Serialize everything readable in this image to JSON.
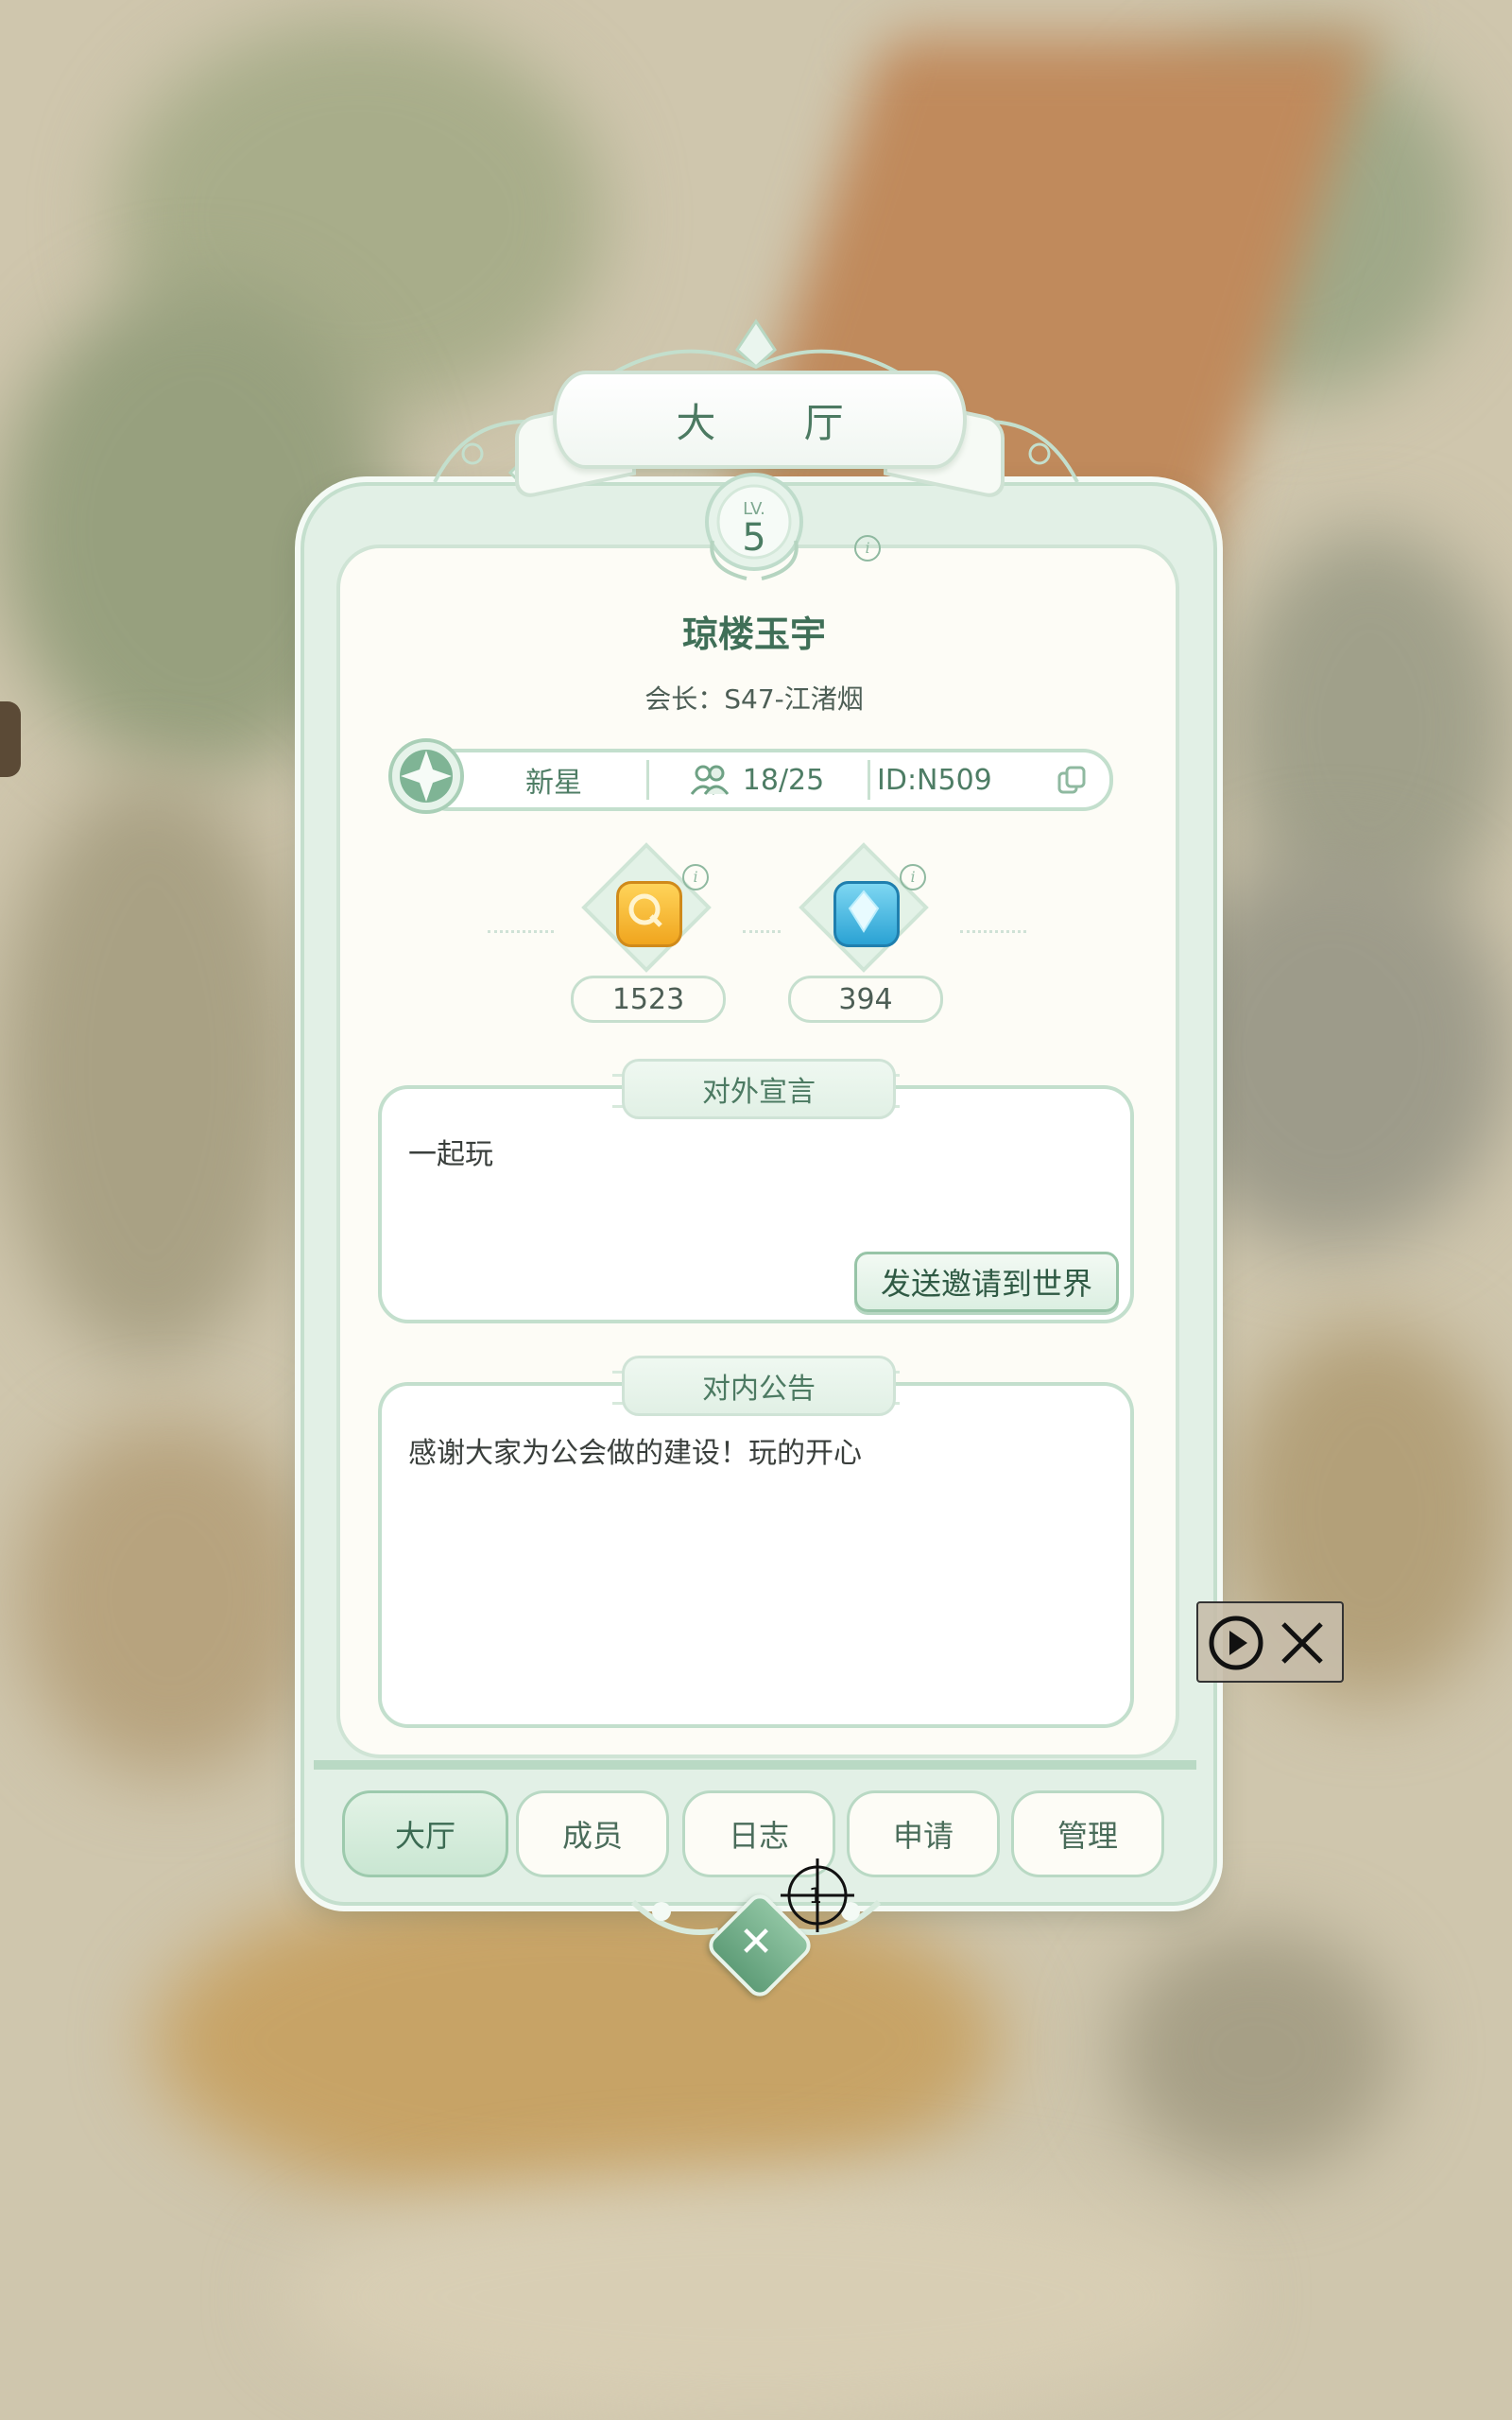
{
  "title": "大 厅",
  "level": {
    "prefix": "LV.",
    "value": "5"
  },
  "guild": {
    "name": "琼楼玉宇",
    "leader_label": "会长：S47-江渚烟",
    "rank": "新星",
    "members": "18/25",
    "id": "ID:N509"
  },
  "resources": [
    {
      "icon": "gold-coin-icon",
      "value": "1523"
    },
    {
      "icon": "blue-gem-icon",
      "value": "394"
    }
  ],
  "declaration": {
    "header": "对外宣言",
    "text": "一起玩",
    "button": "发送邀请到世界"
  },
  "notice": {
    "header": "对内公告",
    "text": "感谢大家为公会做的建设！玩的开心"
  },
  "tabs": [
    "大厅",
    "成员",
    "日志",
    "申请",
    "管理"
  ],
  "crosshair_label": "1",
  "colors": {
    "accent": "#4c7a62",
    "panel": "#e2f0e6",
    "paper": "#fdfcf6",
    "border": "#c3dfcd"
  }
}
